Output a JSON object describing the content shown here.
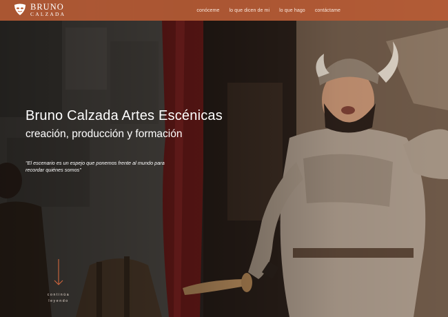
{
  "brand": {
    "name": "BRUNO",
    "sub": "CALZADA",
    "icon": "theater-mask-icon",
    "color": "#be5f37"
  },
  "nav": {
    "items": [
      "conóceme",
      "lo que dicen de mi",
      "lo que hago",
      "contáctame"
    ]
  },
  "hero": {
    "title": "Bruno Calzada Artes Escénicas",
    "subtitle": "creación, producción y formación",
    "quote": "\"El escenario es un espejo que ponemos frente al mundo para recordar quiénes somos\"",
    "scroll_line1": "continúa",
    "scroll_line2": "leyendo",
    "scroll_icon": "arrow-down-icon",
    "accent": "#d0663d"
  }
}
